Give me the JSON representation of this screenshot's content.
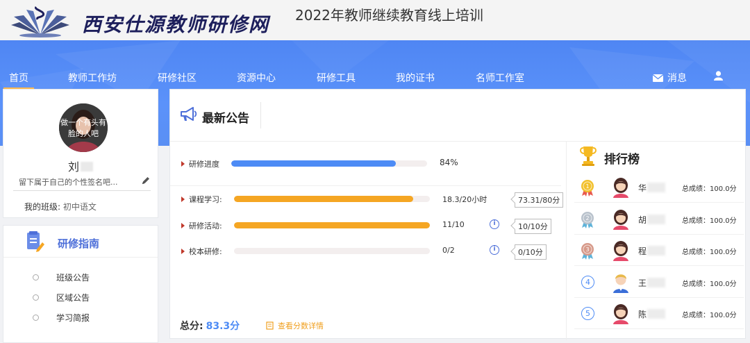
{
  "header": {
    "logo_text": "西安仕源教师研修网",
    "site_title": "2022年教师继续教育线上培训"
  },
  "nav": {
    "items": [
      "首页",
      "教师工作坊",
      "研修社区",
      "资源中心",
      "研修工具",
      "我的证书",
      "名师工作室"
    ],
    "messages_label": "消息"
  },
  "colors": {
    "banner": "#5a8ff4",
    "accent_blue": "#4d8bf5",
    "progress_orange": "#f5a623",
    "nav_active_underline": "#ffb84d"
  },
  "profile": {
    "avatar_text": "做一个有头有脸的人吧",
    "name": "刘",
    "signature": "留下属于自己的个性签名吧...",
    "class_label": "我的班级:",
    "class_value": "初中语文"
  },
  "guide": {
    "title": "研修指南",
    "links": [
      "班级公告",
      "区域公告",
      "学习简报"
    ]
  },
  "announcement": {
    "title": "最新公告",
    "progress": {
      "label": "研修进度",
      "percent": 84,
      "percent_text": "84%"
    },
    "items": [
      {
        "label": "课程学习:",
        "value": "18.3/20小时",
        "score": "73.31/80分",
        "fraction": 0.915
      },
      {
        "label": "研修活动:",
        "value": "11/10",
        "score": "10/10分",
        "fraction": 1.0
      },
      {
        "label": "校本研修:",
        "value": "0/2",
        "score": "0/10分",
        "fraction": 0
      }
    ],
    "total_label": "总分:",
    "total_value": "83.3分",
    "detail_link": "查看分数详情"
  },
  "ranking": {
    "title": "排行榜",
    "rows": [
      {
        "rank": "1",
        "name": "华",
        "score": "总成绩：100.0分"
      },
      {
        "rank": "2",
        "name": "胡",
        "score": "总成绩：100.0分"
      },
      {
        "rank": "3",
        "name": "程",
        "score": "总成绩：100.0分"
      },
      {
        "rank": "4",
        "name": "王",
        "score": "总成绩：100.0分"
      },
      {
        "rank": "5",
        "name": "陈",
        "score": "总成绩：100.0分"
      }
    ]
  }
}
